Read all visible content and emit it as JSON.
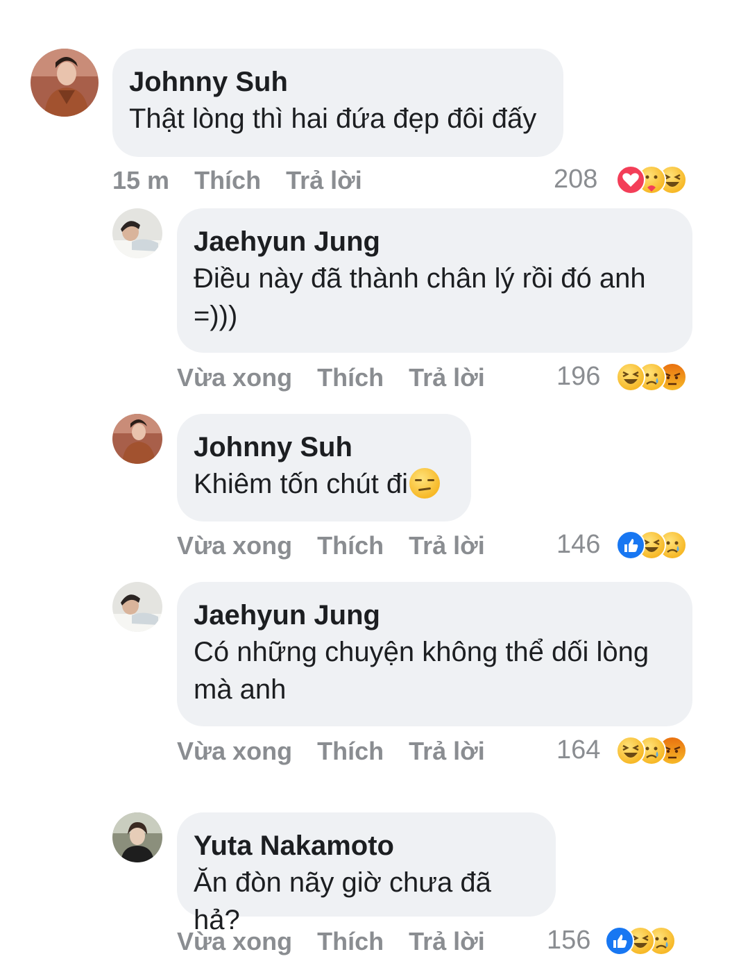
{
  "comments": [
    {
      "author": "Johnny Suh",
      "text": "Thật lòng thì hai đứa đẹp đôi đấy",
      "time": "15 m",
      "like_label": "Thích",
      "reply_label": "Trả lời",
      "reaction_count": "208",
      "reactions": [
        "love-icon",
        "care-icon",
        "haha-icon"
      ]
    },
    {
      "author": "Jaehyun Jung",
      "text": "Điều này đã thành chân lý rồi đó anh =)))",
      "time": "Vừa xong",
      "like_label": "Thích",
      "reply_label": "Trả lời",
      "reaction_count": "196",
      "reactions": [
        "haha-icon",
        "sad-icon",
        "angry-icon"
      ]
    },
    {
      "author": "Johnny Suh",
      "text": "Khiêm tốn chút đi",
      "emoji": "unamused-face-emoji",
      "time": "Vừa xong",
      "like_label": "Thích",
      "reply_label": "Trả lời",
      "reaction_count": "146",
      "reactions": [
        "like-icon",
        "haha-icon",
        "sad-icon"
      ]
    },
    {
      "author": "Jaehyun Jung",
      "text": "Có những chuyện không thể dối lòng mà anh",
      "time": "Vừa xong",
      "like_label": "Thích",
      "reply_label": "Trả lời",
      "reaction_count": "164",
      "reactions": [
        "haha-icon",
        "sad-icon",
        "angry-icon"
      ]
    },
    {
      "author": "Yuta Nakamoto",
      "text": "Ăn đòn nãy giờ chưa đã hả?",
      "time": "Vừa xong",
      "like_label": "Thích",
      "reply_label": "Trả lời",
      "reaction_count": "156",
      "reactions": [
        "like-icon",
        "haha-icon",
        "sad-icon"
      ]
    }
  ],
  "colors": {
    "bubble": "#eff1f4",
    "meta_text": "#8a8d91",
    "like_blue": "#1877f2",
    "love_red": "#f33e58",
    "emoji_yellow": "#f7b928",
    "angry_orange": "#e9710f"
  }
}
